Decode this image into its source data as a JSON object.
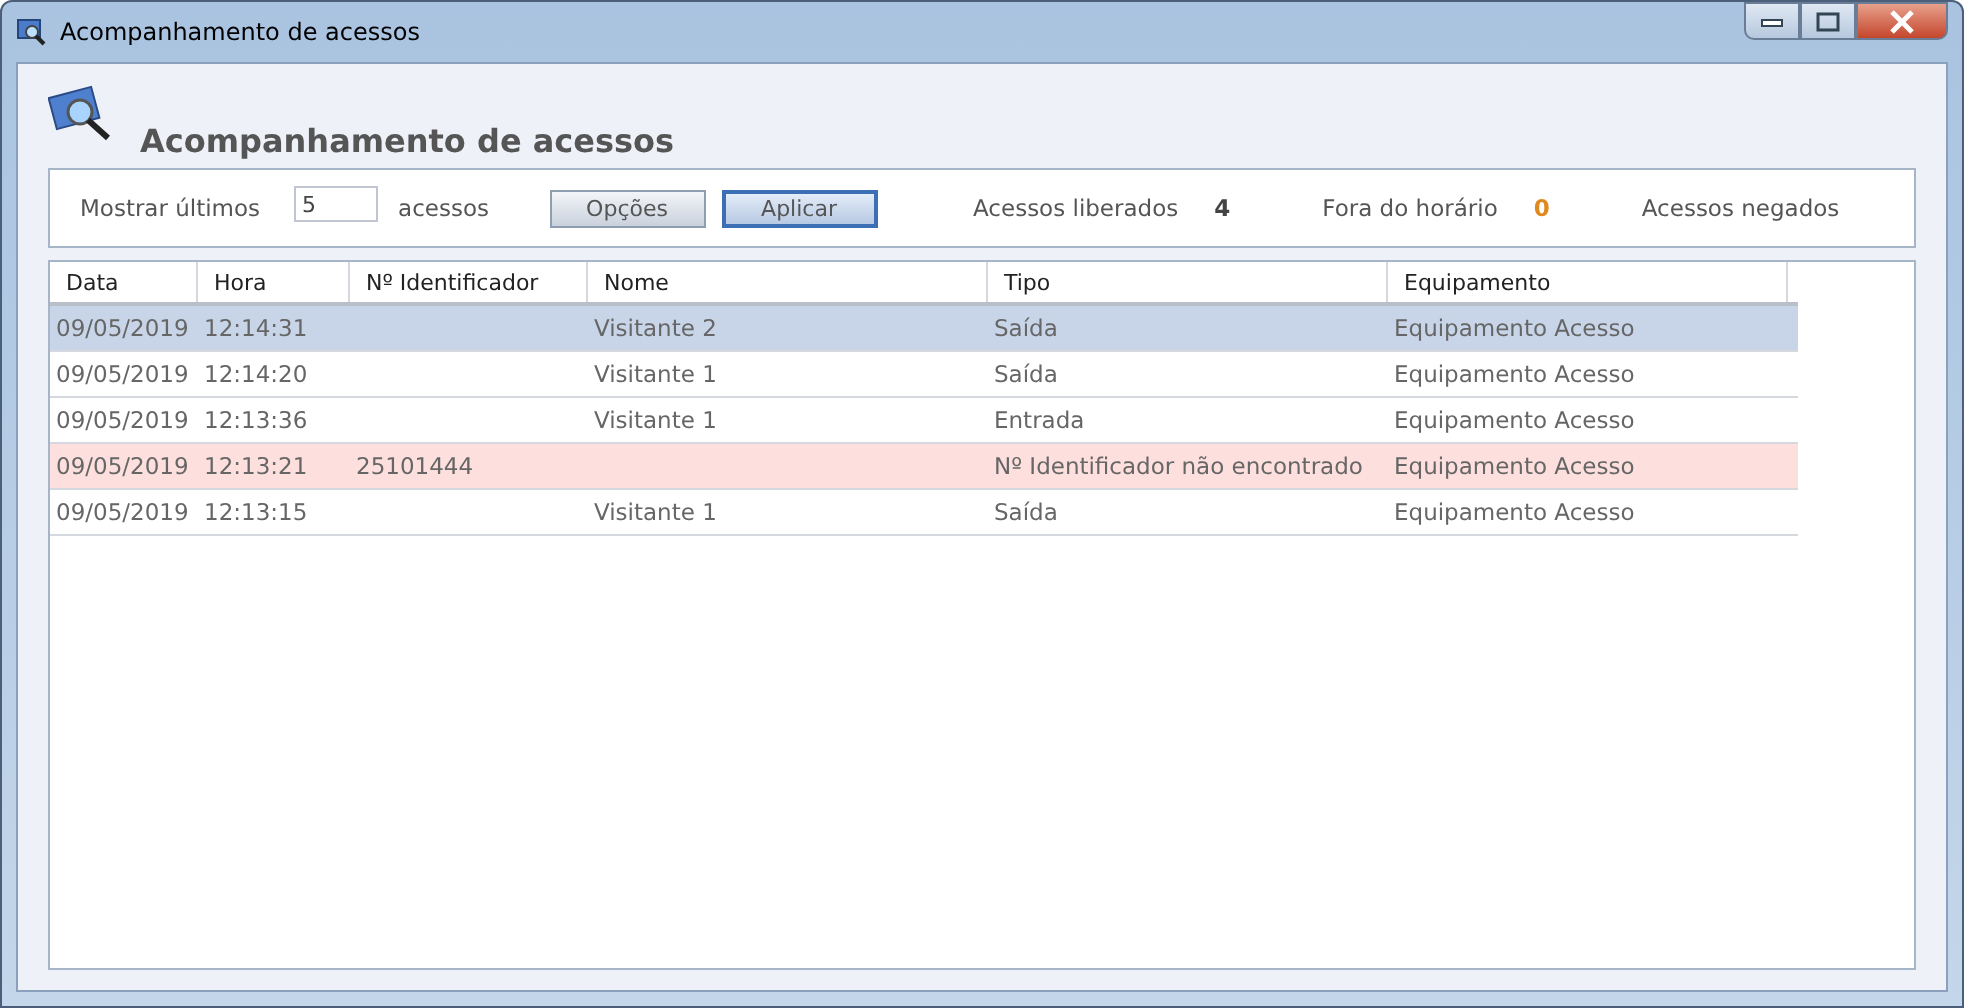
{
  "window": {
    "title": "Acompanhamento de acessos"
  },
  "heading": "Acompanhamento de acessos",
  "filter": {
    "label": "Mostrar últimos",
    "value": "5",
    "suffix": "acessos",
    "buttons": [
      {
        "label": "Opções",
        "kind": "plain"
      },
      {
        "label": "Aplicar",
        "kind": "default"
      }
    ]
  },
  "stats": [
    {
      "label": "Acessos liberados",
      "count": "4",
      "color": "#444444"
    },
    {
      "label": "Fora do horário",
      "count": "0",
      "color": "#e08a1e"
    },
    {
      "label": "Acessos negados"
    }
  ],
  "table": {
    "columns": [
      "Data",
      "Hora",
      "Nº Identificador",
      "Nome",
      "Tipo",
      "Equipamento"
    ],
    "rows": [
      {
        "selected": true,
        "kind": "normal",
        "cells": [
          "09/05/2019",
          "12:14:31",
          "",
          "Visitante 2",
          "Saída",
          "Equipamento Acesso"
        ]
      },
      {
        "selected": false,
        "kind": "normal",
        "cells": [
          "09/05/2019",
          "12:14:20",
          "",
          "Visitante 1",
          "Saída",
          "Equipamento Acesso"
        ]
      },
      {
        "selected": false,
        "kind": "normal",
        "cells": [
          "09/05/2019",
          "12:13:36",
          "",
          "Visitante 1",
          "Entrada",
          "Equipamento Acesso"
        ]
      },
      {
        "selected": false,
        "kind": "denied",
        "cells": [
          "09/05/2019",
          "12:13:21",
          "25101444",
          "",
          "Nº Identificador não encontrado",
          "Equipamento Acesso"
        ]
      },
      {
        "selected": false,
        "kind": "normal",
        "cells": [
          "09/05/2019",
          "12:13:15",
          "",
          "Visitante 1",
          "Saída",
          "Equipamento Acesso"
        ]
      }
    ]
  }
}
